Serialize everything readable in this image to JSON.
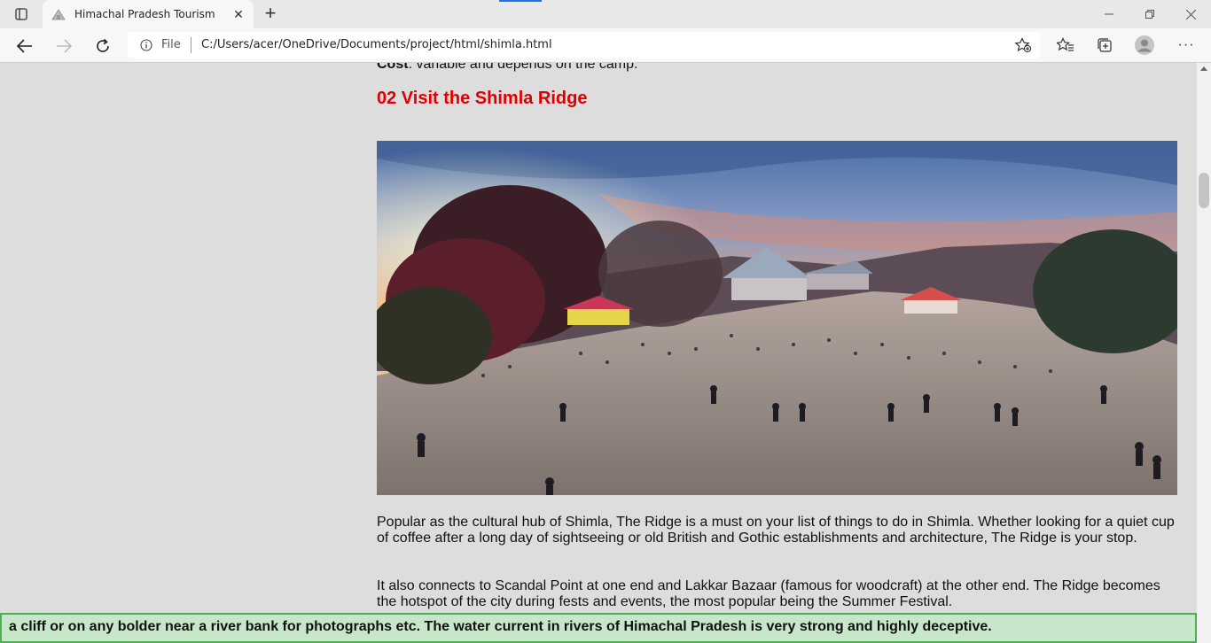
{
  "browser": {
    "tab_title": "Himachal Pradesh Tourism",
    "scheme_label": "File",
    "url": "C:/Users/acer/OneDrive/Documents/project/html/shimla.html"
  },
  "page": {
    "cost_label": "Cost",
    "cost_text": ": variable and depends on the camp.",
    "section_heading": "02 Visit the Shimla Ridge",
    "paragraph_1": "Popular as the cultural hub of Shimla, The Ridge is a must on your list of things to do in Shimla. Whether looking for a quiet cup of coffee after a long day of sightseeing or old British and Gothic establishments and architecture, The Ridge is your stop.",
    "paragraph_2": "It also connects to Scandal Point at one end and Lakkar Bazaar (famous for woodcraft) at the other end. The Ridge becomes the hotspot of the city during fests and events, the most popular being the Summer Festival.",
    "ticker_text": "a cliff or on any bolder near a river bank for photographs etc. The water current in rivers of Himachal Pradesh is very strong and highly deceptive."
  },
  "colors": {
    "heading": "#e00000",
    "ticker_bg": "#c8e6c9",
    "ticker_border": "#4caf50",
    "page_bg": "#dddddd"
  },
  "icons": [
    "tab-actions-icon",
    "tab-favicon",
    "close-icon",
    "plus-icon",
    "minimize-icon",
    "restore-icon",
    "back-arrow-icon",
    "forward-arrow-icon",
    "reload-icon",
    "info-icon",
    "add-favorite-icon",
    "favorites-icon",
    "collections-icon",
    "profile-icon",
    "more-icon"
  ]
}
